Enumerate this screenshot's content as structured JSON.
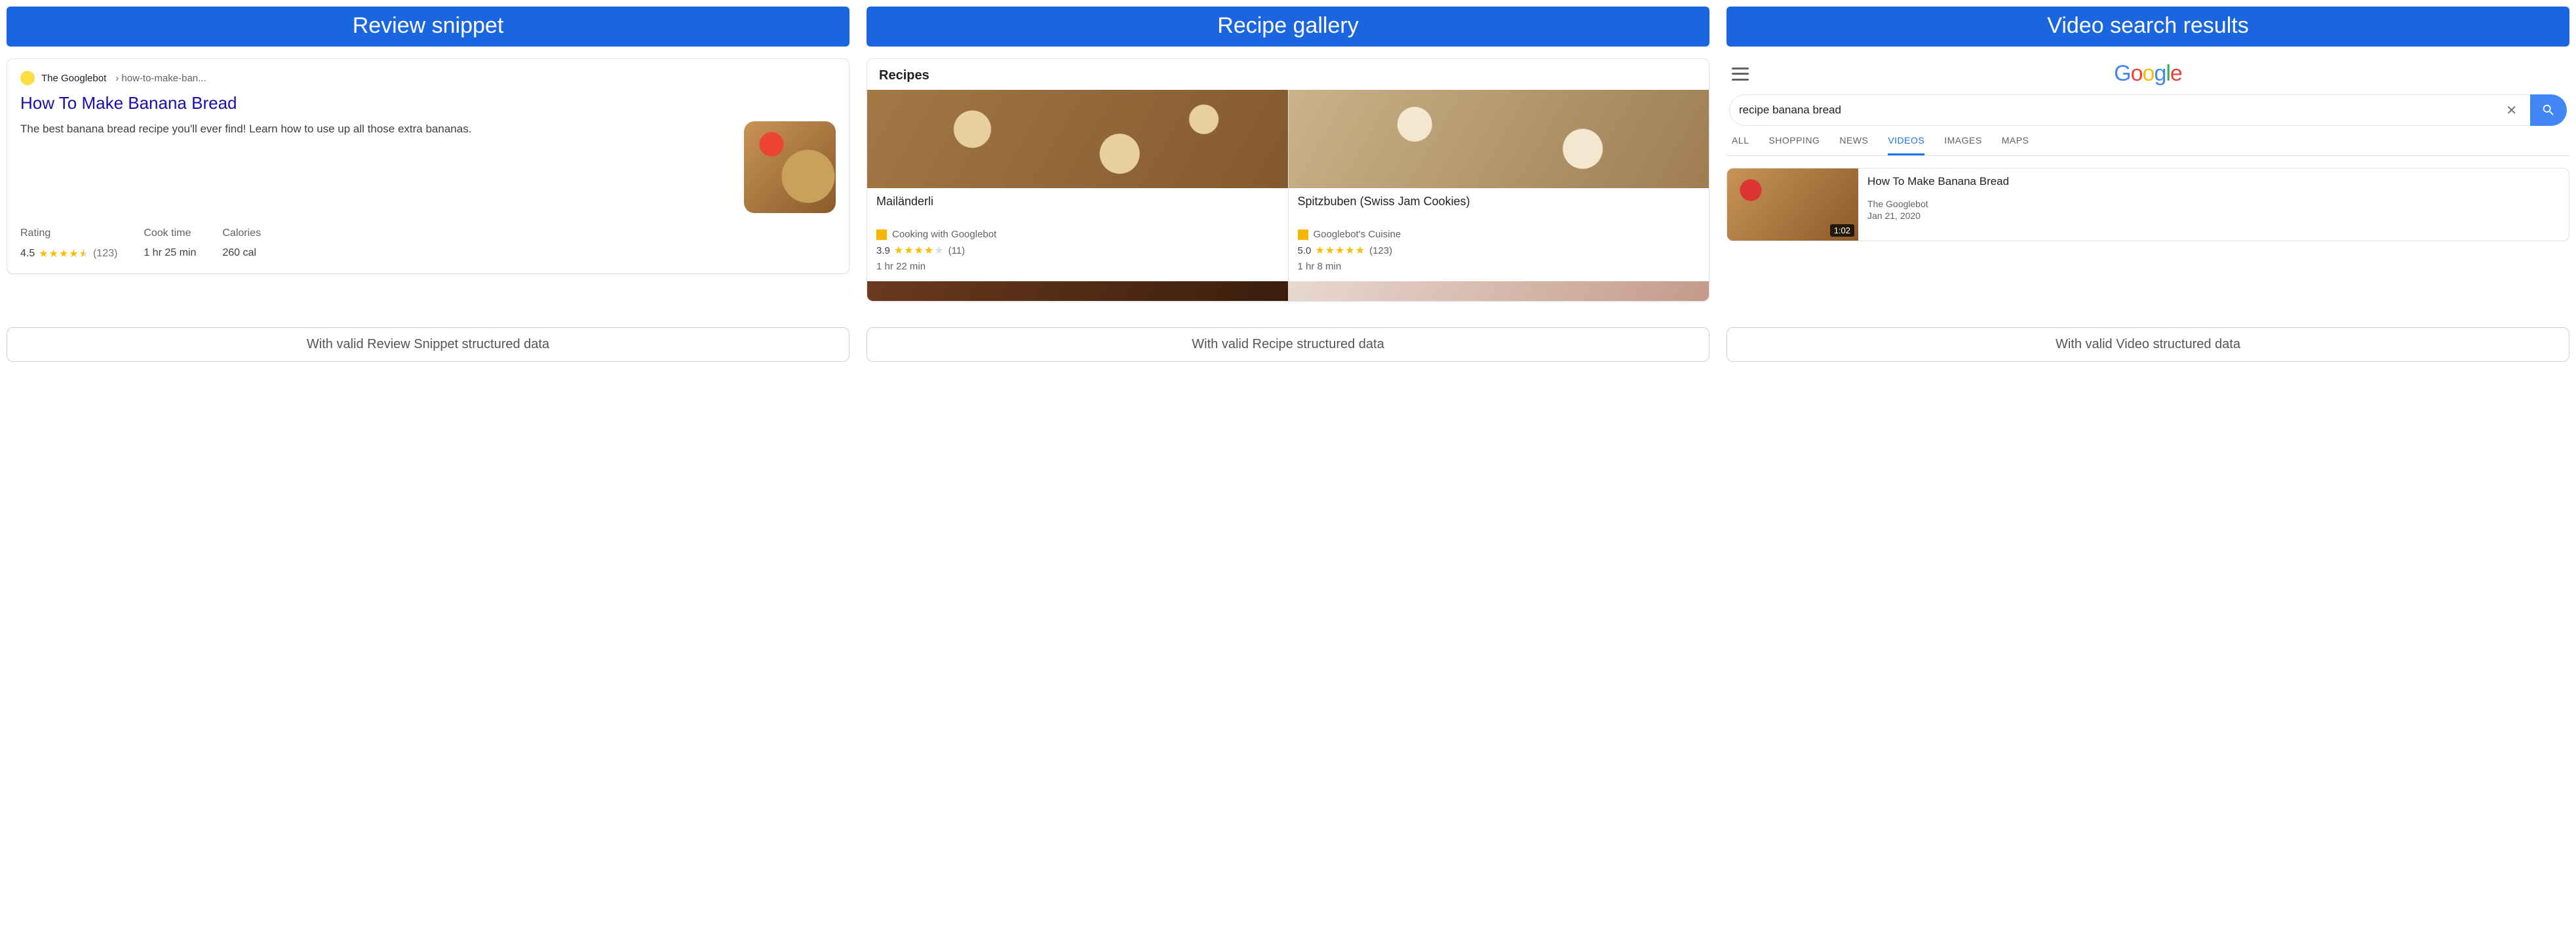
{
  "columns": {
    "review": {
      "header": "Review snippet",
      "source_site": "The Googlebot",
      "source_crumb": "› how-to-make-ban...",
      "title": "How To Make Banana Bread",
      "description": "The best banana bread recipe you'll ever find! Learn how to use up all those extra bananas.",
      "stats": {
        "rating_label": "Rating",
        "rating_value": "4.5",
        "rating_count": "(123)",
        "cook_label": "Cook time",
        "cook_value": "1 hr 25 min",
        "cal_label": "Calories",
        "cal_value": "260 cal"
      },
      "caption": "With valid Review Snippet structured data"
    },
    "gallery": {
      "header": "Recipe gallery",
      "section_title": "Recipes",
      "items": [
        {
          "name": "Mailänderli",
          "author": "Cooking with Googlebot",
          "rating": "3.9",
          "count": "(11)",
          "time": "1 hr 22 min"
        },
        {
          "name": "Spitzbuben (Swiss Jam Cookies)",
          "author": "Googlebot's Cuisine",
          "rating": "5.0",
          "count": "(123)",
          "time": "1 hr 8 min"
        }
      ],
      "caption": "With valid Recipe structured data"
    },
    "video": {
      "header": "Video search results",
      "search_value": "recipe banana bread",
      "tabs": [
        "ALL",
        "SHOPPING",
        "NEWS",
        "VIDEOS",
        "IMAGES",
        "MAPS"
      ],
      "active_tab": "VIDEOS",
      "result": {
        "title": "How To Make Banana Bread",
        "source": "The Googlebot",
        "date": "Jan 21, 2020",
        "duration": "1:02"
      },
      "caption": "With valid Video structured data"
    }
  }
}
